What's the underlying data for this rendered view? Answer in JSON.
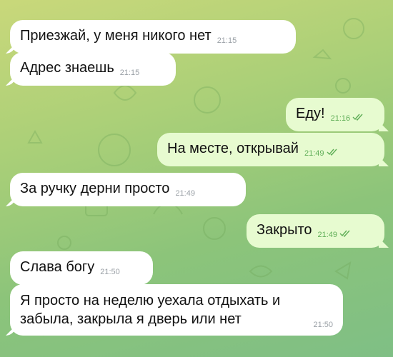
{
  "messages": [
    {
      "dir": "in",
      "text": "Приезжай, у меня никого нет",
      "time": "21:15"
    },
    {
      "dir": "in",
      "text": "Адрес знаешь",
      "time": "21:15"
    },
    {
      "dir": "out",
      "text": "Еду!",
      "time": "21:16",
      "read": true
    },
    {
      "dir": "out",
      "text": "На месте, открывай",
      "time": "21:49",
      "read": true
    },
    {
      "dir": "in",
      "text": "За ручку дерни просто",
      "time": "21:49"
    },
    {
      "dir": "out",
      "text": "Закрыто",
      "time": "21:49",
      "read": true
    },
    {
      "dir": "in",
      "text": "Слава богу",
      "time": "21:50"
    },
    {
      "dir": "in",
      "lines": [
        "Я просто на неделю уехала отдыхать и",
        "забыла, закрыла я дверь или нет"
      ],
      "time": "21:50"
    }
  ],
  "colors": {
    "incoming": "#ffffff",
    "outgoing": "#e7fbd0",
    "read_check": "#5fae57"
  },
  "icons": [
    "double-check-icon"
  ]
}
